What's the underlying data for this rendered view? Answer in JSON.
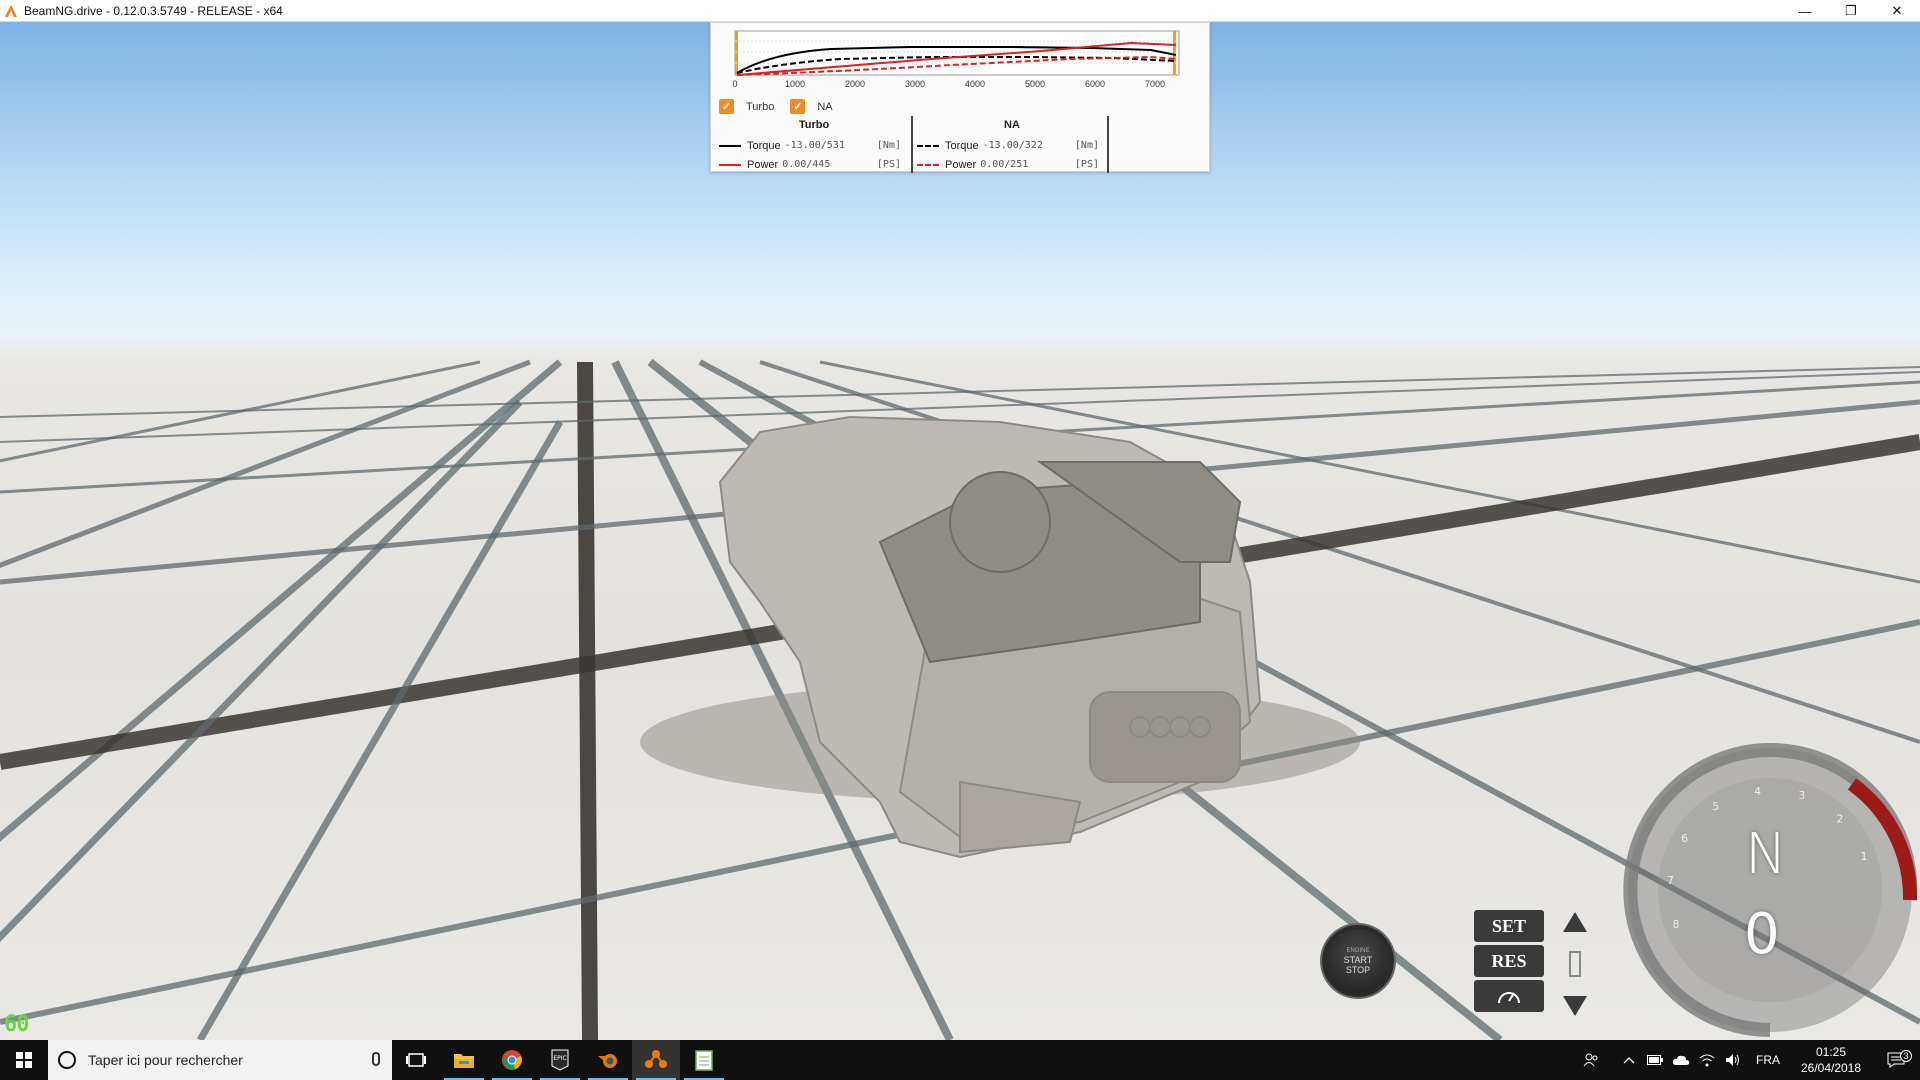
{
  "window": {
    "title": "BeamNG.drive - 0.12.0.3.5749 - RELEASE - x64",
    "minimize": "—",
    "restore": "❐",
    "close": "✕"
  },
  "graph": {
    "x_ticks": [
      "0",
      "1000",
      "2000",
      "3000",
      "4000",
      "5000",
      "6000",
      "7000"
    ],
    "checkboxes": [
      {
        "label": "Turbo",
        "checked": true
      },
      {
        "label": "NA",
        "checked": true
      }
    ],
    "turbo": {
      "header": "Turbo",
      "torque_label": "Torque",
      "torque_value": "-13.00/531",
      "torque_unit": "[Nm]",
      "power_label": "Power",
      "power_value": "0.00/445",
      "power_unit": "[PS]"
    },
    "na": {
      "header": "NA",
      "torque_label": "Torque",
      "torque_value": "-13.00/322",
      "torque_unit": "[Nm]",
      "power_label": "Power",
      "power_value": "0.00/251",
      "power_unit": "[PS]"
    },
    "colors": {
      "torque": "#000000",
      "power": "#e02020",
      "accent": "#f08a24"
    }
  },
  "hud": {
    "fps": "60",
    "engine_button": {
      "line1": "ENGINE",
      "line2": "START",
      "line3": "STOP"
    },
    "cruise": {
      "set": "SET",
      "res": "RES"
    },
    "gear": "N",
    "speed": "0",
    "gauge_ticks": [
      "1",
      "2",
      "3",
      "4",
      "5",
      "6",
      "7",
      "8"
    ]
  },
  "taskbar": {
    "search_placeholder": "Taper ici pour rechercher",
    "apps": [
      "task-view",
      "file-explorer",
      "chrome",
      "epic-games",
      "blender",
      "beamng",
      "notepad"
    ],
    "language": "FRA",
    "time": "01:25",
    "date": "26/04/2018",
    "notification_count": "3"
  }
}
